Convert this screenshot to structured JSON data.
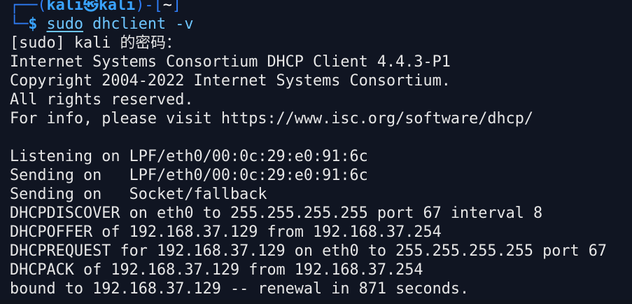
{
  "prompt": {
    "top_prefix": "┌──(",
    "user": "kali",
    "at_symbol": "㉿",
    "host": "kali",
    "mid": ")-[",
    "cwd": "~",
    "close": "]",
    "bottom_prefix": "└─",
    "dollar": "$",
    "command_sudo": "sudo",
    "command_rest": "dhclient -v"
  },
  "output_lines": [
    "[sudo] kali 的密码：",
    "Internet Systems Consortium DHCP Client 4.4.3-P1",
    "Copyright 2004-2022 Internet Systems Consortium.",
    "All rights reserved.",
    "For info, please visit https://www.isc.org/software/dhcp/",
    "",
    "Listening on LPF/eth0/00:0c:29:e0:91:6c",
    "Sending on   LPF/eth0/00:0c:29:e0:91:6c",
    "Sending on   Socket/fallback",
    "DHCPDISCOVER on eth0 to 255.255.255.255 port 67 interval 8",
    "DHCPOFFER of 192.168.37.129 from 192.168.37.254",
    "DHCPREQUEST for 192.168.37.129 on eth0 to 255.255.255.255 port 67",
    "DHCPACK of 192.168.37.129 from 192.168.37.254",
    "bound to 192.168.37.129 -- renewal in 871 seconds."
  ]
}
